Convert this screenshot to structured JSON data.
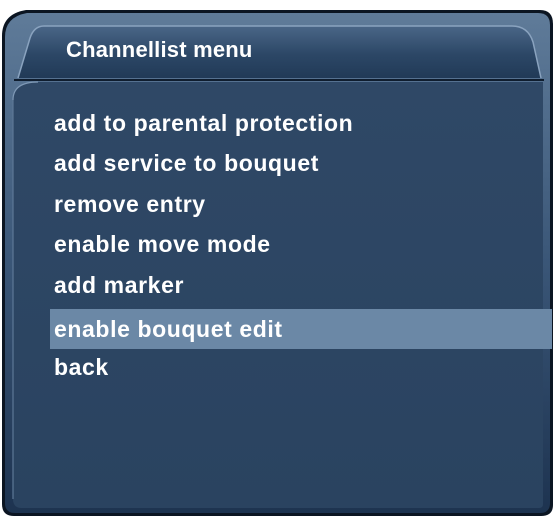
{
  "window": {
    "title": "Channellist menu"
  },
  "menu": {
    "items": [
      {
        "label": "add to parental protection",
        "selected": false
      },
      {
        "label": "add service to bouquet",
        "selected": false
      },
      {
        "label": "remove entry",
        "selected": false
      },
      {
        "label": "enable move mode",
        "selected": false
      },
      {
        "label": "add marker",
        "selected": false
      },
      {
        "label": "enable bouquet edit",
        "selected": true
      },
      {
        "label": "back",
        "selected": false
      }
    ]
  },
  "colors": {
    "panel_background": "#2f4865",
    "selection_highlight": "#6b88a6",
    "frame_border": "#0b1522",
    "text": "#ffffff"
  }
}
